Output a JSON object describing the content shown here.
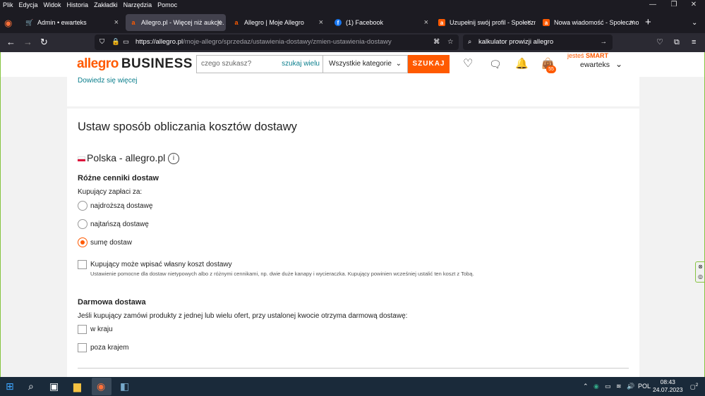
{
  "browser": {
    "menu": [
      "Plik",
      "Edycja",
      "Widok",
      "Historia",
      "Zakładki",
      "Narzędzia",
      "Pomoc"
    ],
    "tabs": [
      {
        "title": "Admin • ewarteks",
        "close": "×"
      },
      {
        "title": "Allegro.pl - Więcej niż aukcje. N",
        "close": "×"
      },
      {
        "title": "Allegro | Moje Allegro",
        "close": "×"
      },
      {
        "title": "(1) Facebook",
        "close": "×"
      },
      {
        "title": "Uzupełnij swój profil - Społeczn",
        "close": "×"
      },
      {
        "title": "Nowa wiadomość - Społecznośc",
        "close": "×"
      }
    ],
    "new_tab": "+",
    "url_host": "https://allegro.pl",
    "url_path": "/moje-allegro/sprzedaz/ustawienia-dostawy/zmien-ustawienia-dostawy",
    "search_value": "kalkulator prowizji allegro"
  },
  "header": {
    "logo_brand": "allegro",
    "logo_business": "BUSINESS",
    "search_placeholder": "czego szukasz?",
    "search_many": "szukaj wielu",
    "category": "Wszystkie kategorie",
    "search_button": "SZUKAJ",
    "cart_count": "55",
    "smart_prefix": "jesteś",
    "smart_label": "SMART",
    "username": "ewarteks"
  },
  "top_panel": {
    "link": "Dowiedz się więcej"
  },
  "main": {
    "title": "Ustaw sposób obliczania kosztów dostawy",
    "country": "Polska - allegro.pl",
    "price_lists_heading": "Różne cenniki dostaw",
    "buyer_pays_label": "Kupujący zapłaci za:",
    "options": [
      {
        "label": "najdroższą dostawę",
        "checked": false
      },
      {
        "label": "najtańszą dostawę",
        "checked": false
      },
      {
        "label": "sumę dostaw",
        "checked": true
      }
    ],
    "own_cost_label": "Kupujący może wpisać własny koszt dostawy",
    "own_cost_help": "Ustawienie pomocne dla dostaw nietypowych albo z różnymi cennikami, np. dwie duże kanapy i wycieraczka. Kupujący powinien wcześniej ustalić ten koszt z Tobą.",
    "free_heading": "Darmowa dostawa",
    "free_desc": "Jeśli kupujący zamówi produkty z jednej lub wielu ofert, przy ustalonej kwocie otrzyma darmową dostawę:",
    "free_domestic": "w kraju",
    "free_abroad": "poza krajem"
  },
  "taskbar": {
    "lang": "POL",
    "time": "08:43",
    "date": "24.07.2023",
    "notifications": "2"
  }
}
